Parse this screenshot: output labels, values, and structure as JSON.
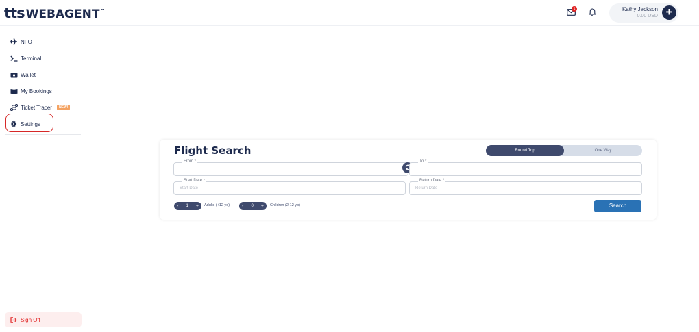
{
  "brand": {
    "logo_left": "tts",
    "logo_right": "WEBAGENT",
    "trademark": "™"
  },
  "header": {
    "mail_badge_count": "1",
    "user_name": "Kathy Jackson",
    "user_balance": "0.00 USD",
    "icons": {
      "mail": "mail-icon",
      "bell": "bell-icon",
      "add": "plus-icon"
    }
  },
  "sidebar": {
    "items": [
      {
        "label": "NFO",
        "icon": "airplane-icon"
      },
      {
        "label": "Terminal",
        "icon": "terminal-icon"
      },
      {
        "label": "Wallet",
        "icon": "wallet-icon"
      },
      {
        "label": "My Bookings",
        "icon": "book-icon"
      },
      {
        "label": "Ticket Tracer",
        "icon": "route-icon",
        "badge": "NEW!"
      },
      {
        "label": "Settings",
        "icon": "gear-icon"
      }
    ],
    "sign_off": "Sign Off"
  },
  "flight_search": {
    "title": "Flight Search",
    "trip_types": [
      "Round Trip",
      "One Way"
    ],
    "selected_trip_type": "Round Trip",
    "from_label": "From *",
    "to_label": "To *",
    "start_date_label": "Start Date *",
    "start_date_placeholder": "Start Date",
    "return_date_label": "Return Date *",
    "return_date_placeholder": "Return Date",
    "adults_value": "1",
    "adults_label": "Adults (+12 yo)",
    "children_value": "0",
    "children_label": "Children (2-12 yo)",
    "search_label": "Search"
  },
  "colors": {
    "navy": "#1d2a4d",
    "slate": "#3f4a6d",
    "primary_blue": "#2a72b5",
    "alert_red": "#e02424",
    "badge_orange": "#f4a261"
  }
}
